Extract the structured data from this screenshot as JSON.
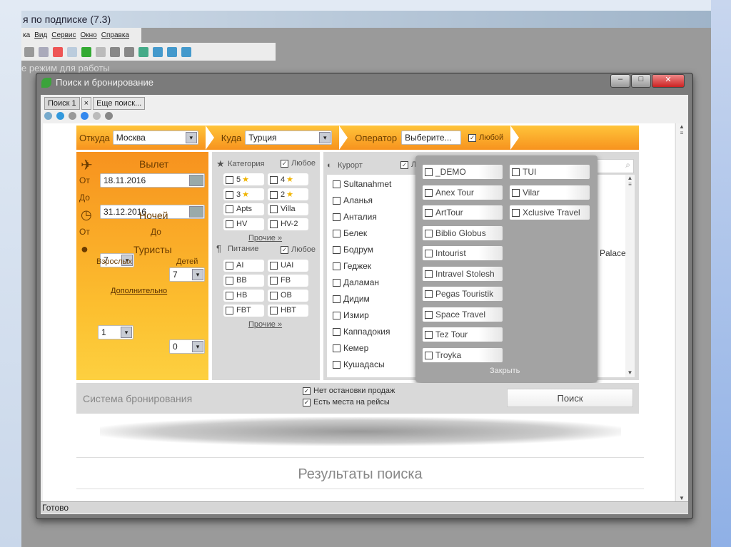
{
  "app": {
    "title": "я по подписке (7.3)",
    "menu": [
      "ка",
      "Вид",
      "Сервис",
      "Окно",
      "Справка"
    ],
    "mode_text": "е режим для работы"
  },
  "dialog": {
    "title": "Поиск и бронирование",
    "min": "–",
    "max": "□",
    "close": "✕",
    "tabs": [
      {
        "label": "Поиск 1"
      },
      {
        "label": "Еще поиск..."
      }
    ],
    "tab_close": "×"
  },
  "route": {
    "from_label": "Откуда",
    "from_value": "Москва",
    "to_label": "Куда",
    "to_value": "Турция",
    "operator_label": "Оператор",
    "operator_value": "Выберите...",
    "any_label": "Любой"
  },
  "left": {
    "departure": "Вылет",
    "from": "От",
    "from_date": "18.11.2016",
    "to": "До",
    "to_date": "31.12.2016",
    "nights": "Ночей",
    "nights_from": "7",
    "nights_to": "7",
    "tourists": "Туристы",
    "adults_label": "Взрослых",
    "adults": "1",
    "children_label": "Детей",
    "children": "0",
    "more": "Дополнительно"
  },
  "category": {
    "title": "Категория",
    "any": "Любое",
    "items": [
      "5",
      "4",
      "3",
      "2",
      "Apts",
      "Villa",
      "HV",
      "HV-2"
    ],
    "more": "Прочие »"
  },
  "meals": {
    "title": "Питание",
    "any": "Любое",
    "items": [
      "AI",
      "UAI",
      "BB",
      "FB",
      "HB",
      "OB",
      "FBT",
      "HBT"
    ],
    "more": "Прочие »"
  },
  "resort": {
    "title": "Курорт",
    "any": "Л",
    "items": [
      "Sultanahmet",
      "Аланья",
      "Анталия",
      "Белек",
      "Бодрум",
      "Геджек",
      "Даламан",
      "Дидим",
      "Измир",
      "Каппадокия",
      "Кемер",
      "Кушадасы"
    ],
    "hotel_partial": "Palace"
  },
  "operators": {
    "col1": [
      "_DEMO",
      "Anex Tour",
      "ArtTour",
      "Biblio Globus",
      "Intourist",
      "Intravel Stolesh",
      "Pegas Touristik",
      "Space Travel",
      "Tez Tour",
      "Troyka"
    ],
    "col2": [
      "TUI",
      "Vilar",
      "Xclusive Travel"
    ],
    "close": "Закрыть"
  },
  "bottom": {
    "system": "Система бронирования",
    "no_stop": "Нет остановки продаж",
    "seats": "Есть места на рейсы",
    "search": "Поиск"
  },
  "results_title": "Результаты поиска",
  "status": "Готово"
}
